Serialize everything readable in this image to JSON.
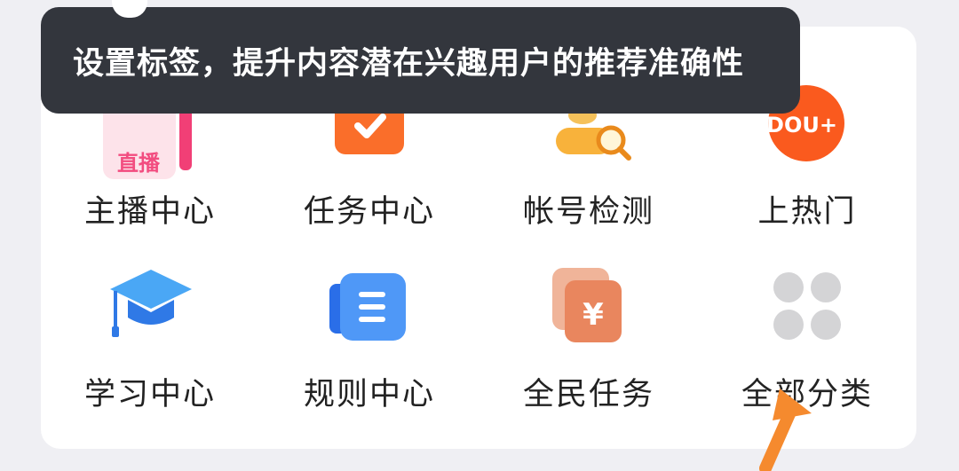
{
  "tooltip": {
    "text": "设置标签，提升内容潜在兴趣用户的推荐准确性"
  },
  "grid": {
    "row1": [
      {
        "label": "主播中心",
        "icon": "live-icon",
        "icon_text": "直播"
      },
      {
        "label": "任务中心",
        "icon": "task-check-icon"
      },
      {
        "label": "帐号检测",
        "icon": "account-check-icon"
      },
      {
        "label": "上热门",
        "icon": "dou-plus-icon",
        "icon_text": "DOU+"
      }
    ],
    "row2": [
      {
        "label": "学习中心",
        "icon": "graduation-cap-icon"
      },
      {
        "label": "规则中心",
        "icon": "rules-doc-icon"
      },
      {
        "label": "全民任务",
        "icon": "yen-cards-icon",
        "icon_text": "¥"
      },
      {
        "label": "全部分类",
        "icon": "all-categories-icon"
      }
    ]
  },
  "colors": {
    "tooltip_bg": "#33363d",
    "arrow": "#f58a2e",
    "page_bg": "#efeff3"
  }
}
